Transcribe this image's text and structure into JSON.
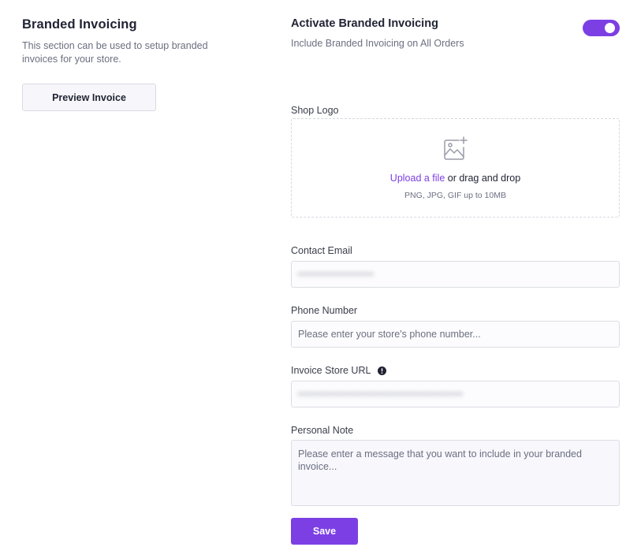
{
  "section": {
    "title": "Branded Invoicing",
    "description": "This section can be used to setup branded invoices for your store.",
    "preview_button": "Preview Invoice"
  },
  "activation": {
    "title": "Activate Branded Invoicing",
    "subtitle": "Include Branded Invoicing on All Orders",
    "enabled": true,
    "accent_color": "#7c3fe4"
  },
  "logo": {
    "label": "Shop Logo",
    "icon": "image-add-icon",
    "upload_link": "Upload a file",
    "upload_rest": " or drag and drop",
    "hint": "PNG, JPG, GIF up to 10MB"
  },
  "contact_email": {
    "label": "Contact Email",
    "value": "••••••••••••••••••"
  },
  "phone": {
    "label": "Phone Number",
    "placeholder": "Please enter your store's phone number...",
    "value": ""
  },
  "store_url": {
    "label": "Invoice Store URL",
    "info_icon": "info-icon",
    "value": "•••••••••••••••••••••••••••••••••••••••"
  },
  "note": {
    "label": "Personal Note",
    "placeholder": "Please enter a message that you want to include in your branded invoice...",
    "value": ""
  },
  "save_button": "Save"
}
